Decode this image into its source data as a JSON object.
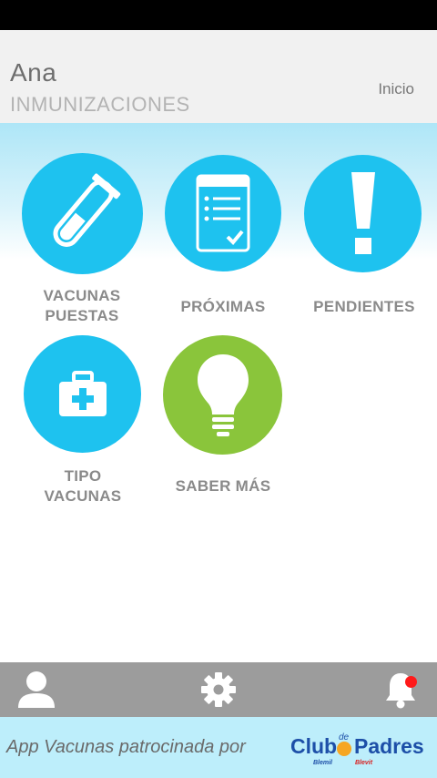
{
  "header": {
    "user_name": "Ana",
    "section_title": "INMUNIZACIONES",
    "home_link": "Inicio"
  },
  "tiles": [
    {
      "label_line1": "VACUNAS",
      "label_line2": "PUESTAS",
      "icon": "test-tube-icon",
      "color": "#1ec2ef"
    },
    {
      "label_line1": "PRÓXIMAS",
      "label_line2": "",
      "icon": "checklist-icon",
      "color": "#1ec2ef"
    },
    {
      "label_line1": "PENDIENTES",
      "label_line2": "",
      "icon": "exclamation-icon",
      "color": "#1ec2ef"
    },
    {
      "label_line1": "TIPO",
      "label_line2": "VACUNAS",
      "icon": "first-aid-kit-icon",
      "color": "#1ec2ef"
    },
    {
      "label_line1": "SABER MÁS",
      "label_line2": "",
      "icon": "lightbulb-icon",
      "color": "#8ac53b"
    }
  ],
  "bottom_nav": {
    "items": [
      {
        "icon": "user-icon"
      },
      {
        "icon": "gear-icon"
      },
      {
        "icon": "bell-icon",
        "has_notification": true
      }
    ]
  },
  "sponsor": {
    "text": "App Vacunas patrocinada por",
    "logo_text_club": "Club",
    "logo_text_de": "de",
    "logo_text_padres": "Padres",
    "logo_sub_left": "Blemil",
    "logo_sub_right": "Blevit"
  },
  "colors": {
    "accent_blue": "#1ec2ef",
    "accent_green": "#8ac53b",
    "nav_gray": "#9c9c9c",
    "notification_red": "#ff1a1a"
  }
}
